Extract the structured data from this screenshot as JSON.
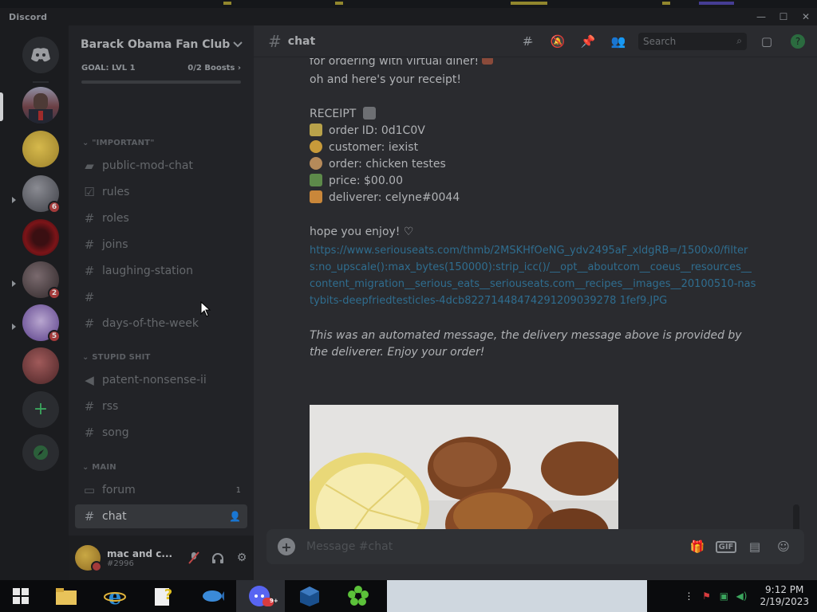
{
  "window": {
    "title": "Discord",
    "controls": [
      "—",
      "☐",
      "✕"
    ]
  },
  "server": {
    "name": "Barack Obama Fan Club",
    "goal_label": "GOAL: LVL 1",
    "boosts": "0/2 Boosts",
    "badges": [
      "6",
      "2",
      "5"
    ]
  },
  "channels": {
    "cat_important": "\"IMPORTANT\"",
    "cat_stupid": "STUPID SHIT",
    "cat_main": "MAIN",
    "public_mod_chat": "public-mod-chat",
    "rules": "rules",
    "roles": "roles",
    "joins": "joins",
    "laughing_station": "laughing-station",
    "unnamed": "",
    "days_of_the_week": "days-of-the-week",
    "patent_nonsense": "patent-nonsense-ii",
    "rss": "rss",
    "song": "song",
    "forum": "forum",
    "forum_count": "1",
    "chat": "chat"
  },
  "user": {
    "name": "mac and c...",
    "tag": "#2996"
  },
  "chat": {
    "channel": "chat",
    "search_placeholder": "Search",
    "lines": {
      "l0": "for ordering with virtual diner!",
      "l1": "oh and here's your receipt!",
      "receipt": "RECEIPT",
      "order_id": "order ID: 0d1C0V",
      "customer": "customer: iexist",
      "order": "order: chicken testes",
      "price": "price: $00.00",
      "deliverer": "deliverer: celyne#0044",
      "enjoy": "hope you enjoy! ♡",
      "link": "https://www.seriouseats.com/thmb/2MSKHfOeNG_ydv2495aF_xldgRB=/1500x0/filters:no_upscale():max_bytes(150000):strip_icc()/__opt__aboutcom__coeus__resources__content_migration__serious_eats__seriouseats.com__recipes__images__20100510-nastybits-deepfriedtesticles-4dcb82271448474291209039278 1fef9.JPG",
      "automated": "This was an automated message, the delivery message above is provided by the deliverer. Enjoy your order!"
    },
    "composer_placeholder": "Message #chat",
    "gif_label": "GIF"
  },
  "taskbar": {
    "discord_badge": "9+",
    "time": "9:12 PM",
    "date": "2/19/2023"
  }
}
